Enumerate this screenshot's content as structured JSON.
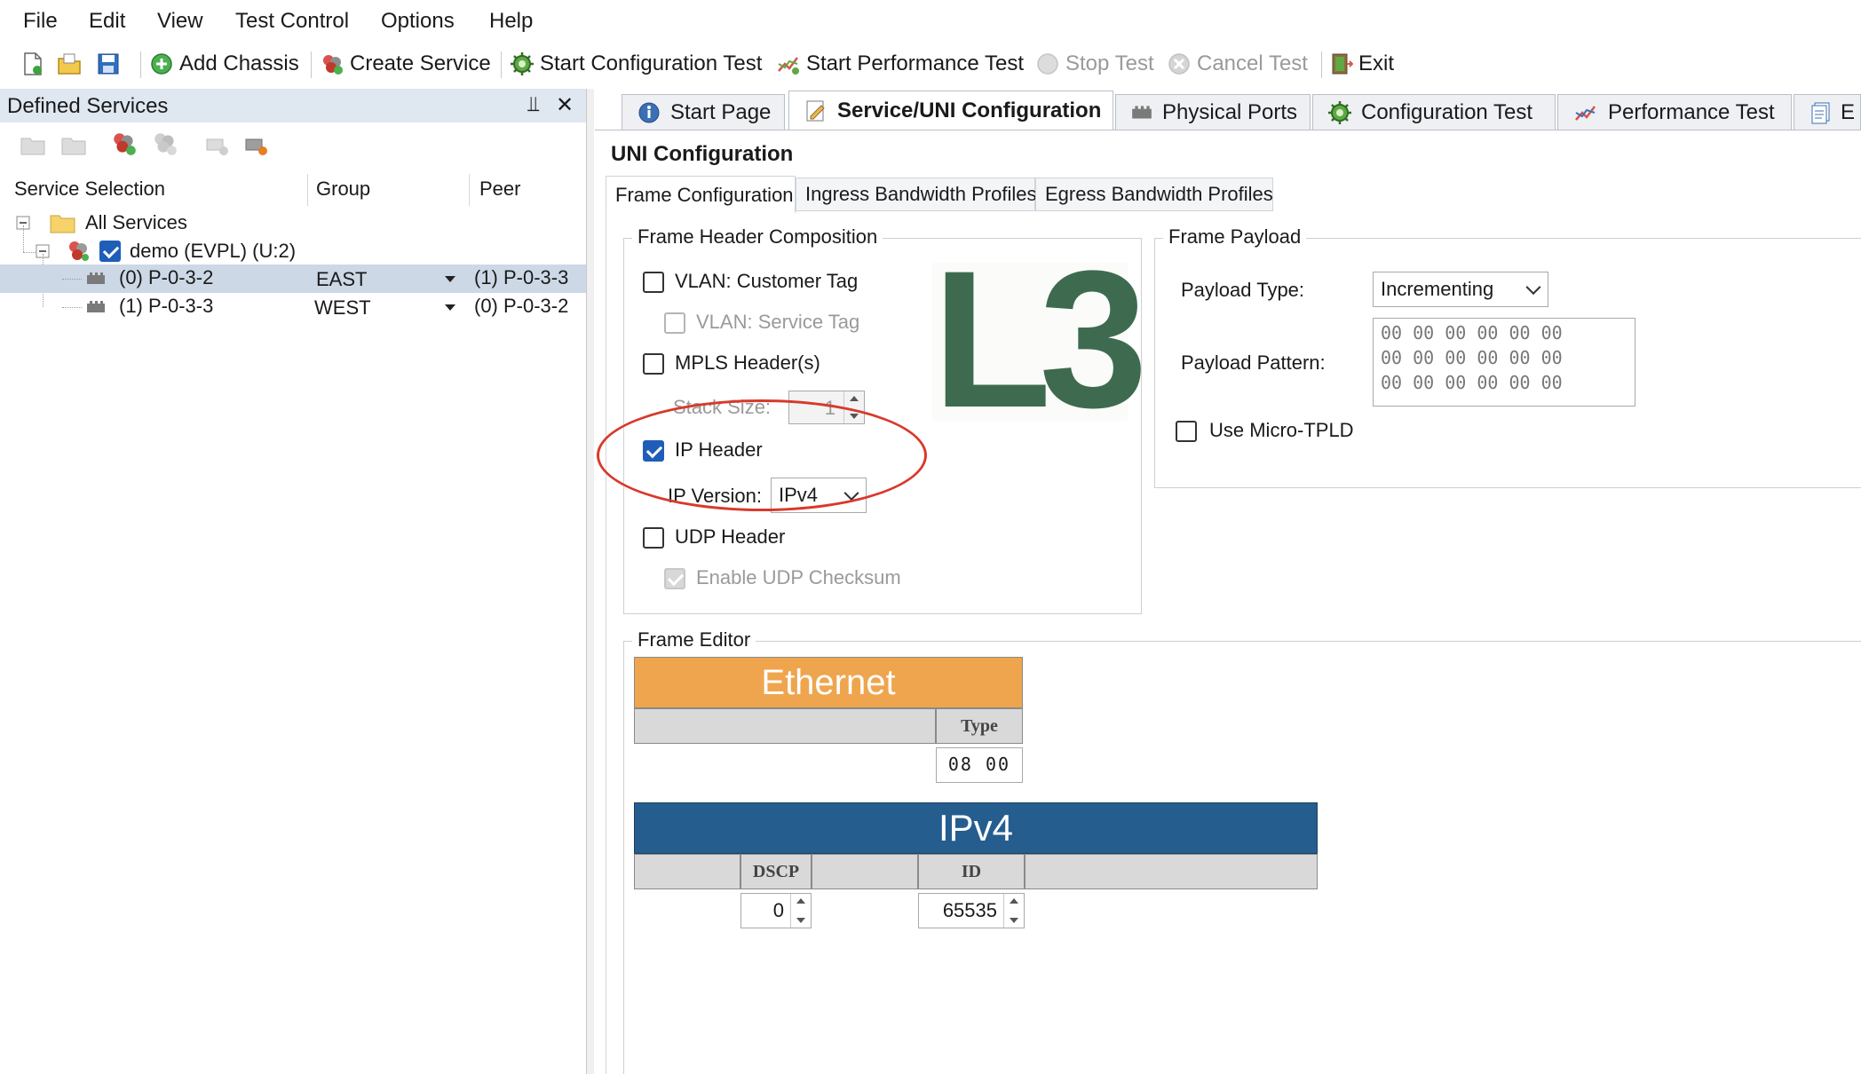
{
  "menu": {
    "items": [
      "File",
      "Edit",
      "View",
      "Test Control",
      "Options",
      "Help"
    ]
  },
  "toolbar": {
    "add_chassis": "Add Chassis",
    "create_service": "Create Service",
    "start_config_test": "Start Configuration Test",
    "start_perf_test": "Start Performance Test",
    "stop_test": "Stop Test",
    "cancel_test": "Cancel Test",
    "exit": "Exit"
  },
  "left_panel": {
    "title": "Defined Services",
    "pin_glyph": "⫫",
    "close_glyph": "✕",
    "columns": [
      "Service Selection",
      "Group",
      "Peer"
    ],
    "root": "All Services",
    "service": "demo (EVPL) (U:2)",
    "ports": [
      {
        "name": "(0) P-0-3-2",
        "group": "EAST",
        "peer": "(1) P-0-3-3"
      },
      {
        "name": "(1) P-0-3-3",
        "group": "WEST",
        "peer": "(0) P-0-3-2"
      }
    ]
  },
  "tabs": [
    "Start Page",
    "Service/UNI Configuration",
    "Physical Ports",
    "Configuration Test",
    "Performance Test",
    "E"
  ],
  "uni": {
    "title": "UNI Configuration",
    "subtabs": [
      "Frame Configuration",
      "Ingress Bandwidth Profiles",
      "Egress Bandwidth Profiles"
    ],
    "header_composition": {
      "title": "Frame Header Composition",
      "vlan_customer": "VLAN: Customer Tag",
      "vlan_service": "VLAN: Service Tag",
      "mpls": "MPLS Header(s)",
      "stack_size_label": "Stack Size:",
      "stack_size_value": "1",
      "ip_header": "IP Header",
      "ip_version_label": "IP Version:",
      "ip_version_value": "IPv4",
      "udp_header": "UDP Header",
      "udp_checksum": "Enable UDP Checksum",
      "logo": "L3"
    },
    "payload": {
      "title": "Frame Payload",
      "type_label": "Payload Type:",
      "type_value": "Incrementing",
      "pattern_label": "Payload Pattern:",
      "pattern_rows": [
        "00 00 00 00 00 00",
        "00 00 00 00 00 00",
        "00 00 00 00 00 00"
      ],
      "micro_tpld": "Use Micro-TPLD"
    },
    "frame_editor": {
      "title": "Frame Editor",
      "ethernet": "Ethernet",
      "type_label": "Type",
      "type_value": "08 00",
      "ipv4": "IPv4",
      "dscp_label": "DSCP",
      "dscp_value": "0",
      "id_label": "ID",
      "id_value": "65535"
    }
  },
  "colors": {
    "ethernet_header": "#efa54d",
    "ipv4_header": "#255d8f",
    "l3_logo": "#3e6b50",
    "highlight_ring": "#d8392b",
    "checkbox_on": "#1e5eb8"
  }
}
